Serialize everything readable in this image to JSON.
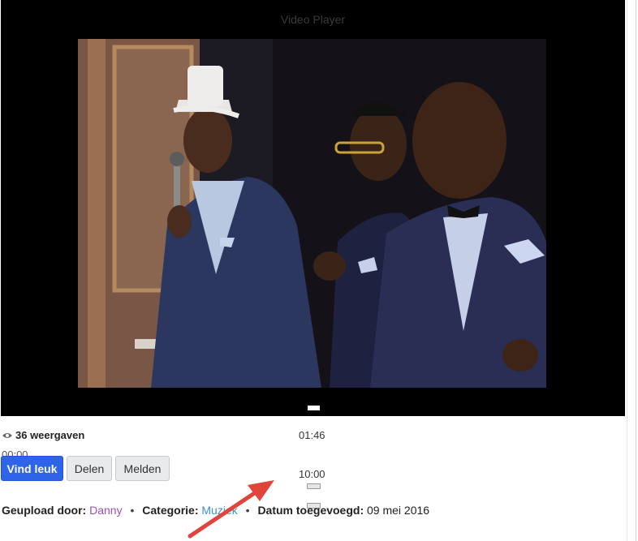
{
  "player": {
    "title": "Video Player",
    "time_current": "00:00",
    "time_duration": "01:46",
    "time_end": "10:00"
  },
  "stats": {
    "views_label": "36 weergaven"
  },
  "actions": {
    "like_label": "Vind leuk",
    "share_label": "Delen",
    "report_label": "Melden"
  },
  "meta": {
    "uploaded_by_label": "Geupload door:",
    "uploaded_by_value": "Danny",
    "category_label": "Categorie:",
    "category_value": "Muziek",
    "date_label": "Datum toegevoegd:",
    "date_value": "09 mei 2016"
  },
  "colors": {
    "accent": "#2f64e8",
    "arrow": "#e0443a",
    "uploader_link": "#9b4fb8",
    "category_link": "#3a8fd0"
  },
  "icons": {
    "views": "eye-icon"
  }
}
